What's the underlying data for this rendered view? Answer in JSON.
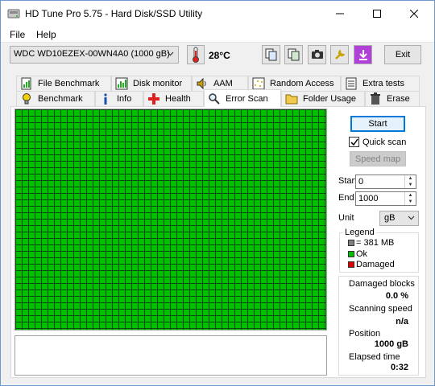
{
  "window": {
    "title": "HD Tune Pro 5.75 - Hard Disk/SSD Utility"
  },
  "menu": {
    "file_label": "File",
    "help_label": "Help"
  },
  "toolbar": {
    "drive": "WDC WD10EZEX-00WN4A0 (1000 gB)",
    "temperature": "28°C",
    "exit_label": "Exit"
  },
  "tabs_back": [
    {
      "label": "File Benchmark",
      "icon": "file-benchmark-icon"
    },
    {
      "label": "Disk monitor",
      "icon": "disk-monitor-icon"
    },
    {
      "label": "AAM",
      "icon": "speaker-icon"
    },
    {
      "label": "Random Access",
      "icon": "random-access-icon"
    },
    {
      "label": "Extra tests",
      "icon": "extra-tests-icon"
    }
  ],
  "tabs_front": [
    {
      "label": "Benchmark",
      "icon": "bulb-icon"
    },
    {
      "label": "Info",
      "icon": "info-icon"
    },
    {
      "label": "Health",
      "icon": "health-cross-icon"
    },
    {
      "label": "Error Scan",
      "icon": "magnifier-icon"
    },
    {
      "label": "Folder Usage",
      "icon": "folder-icon"
    },
    {
      "label": "Erase",
      "icon": "trash-icon"
    }
  ],
  "active_tab": "Error Scan",
  "scan": {
    "start_label": "Start",
    "quick_scan_label": "Quick scan",
    "quick_scan_checked": true,
    "speed_map_label": "Speed map",
    "start_field_label": "Start",
    "start_value": "0",
    "end_field_label": "End",
    "end_value": "1000",
    "unit_label": "Unit",
    "unit_value": "gB"
  },
  "legend": {
    "title": "Legend",
    "block_size": "= 381 MB",
    "ok_label": "Ok",
    "damaged_label": "Damaged",
    "colors": {
      "block": "#808080",
      "ok": "#00c000",
      "damaged": "#e00000"
    }
  },
  "stats": {
    "damaged_blocks_label": "Damaged blocks",
    "damaged_blocks_value": "0.0 %",
    "scanning_speed_label": "Scanning speed",
    "scanning_speed_value": "n/a",
    "position_label": "Position",
    "position_value": "1000 gB",
    "elapsed_label": "Elapsed time",
    "elapsed_value": "0:32"
  }
}
